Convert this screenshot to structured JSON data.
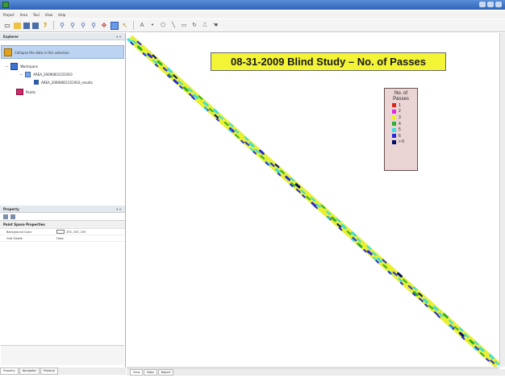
{
  "window": {
    "title": ""
  },
  "menu": [
    "Project",
    "Area",
    "Tool",
    "View",
    "Help"
  ],
  "toolbar": {
    "icons": [
      "new-icon",
      "open-icon",
      "save-icon",
      "save-all-icon",
      "help-icon",
      "zoom-in-icon",
      "zoom-out-icon",
      "zoom-extent-icon",
      "zoom-full-icon",
      "pan-icon",
      "select-icon",
      "pointer-icon",
      "draw-text-icon",
      "draw-point-icon",
      "draw-polygon-icon",
      "draw-line-icon",
      "measure-icon",
      "rotate-icon",
      "ruler-icon",
      "hand-icon"
    ]
  },
  "explorer": {
    "title": "Explorer",
    "pin": "▾ ×",
    "highlight": "Collapse the data in this selection",
    "tree": {
      "workspace": "Workspace",
      "area": "AREA_20090831151910",
      "layer": "AREA_20090831151910_results",
      "points": "Points"
    }
  },
  "property": {
    "title": "Property",
    "pin": "▾ ×",
    "category": "Point Space Properties",
    "rows": [
      {
        "name": "Background Color",
        "value": "255, 255, 255"
      },
      {
        "name": "Grid Visible",
        "value": "False"
      }
    ]
  },
  "left_tabs": [
    "Property",
    "Navigator",
    "Protocol"
  ],
  "map": {
    "title": "08-31-2009 Blind Study – No. of Passes",
    "legend_title_line1": "No. of",
    "legend_title_line2": "Passes",
    "legend": [
      {
        "label": "1",
        "color": "#e0241c"
      },
      {
        "label": "2",
        "color": "#e02ae0"
      },
      {
        "label": "3",
        "color": "#f0f020"
      },
      {
        "label": "4",
        "color": "#2ab02a"
      },
      {
        "label": "5",
        "color": "#38dede"
      },
      {
        "label": "6",
        "color": "#2a2ad8"
      },
      {
        "label": "> 6",
        "color": "#00106a"
      }
    ]
  },
  "bottom_tabs": [
    "View",
    "Data",
    "Report"
  ]
}
